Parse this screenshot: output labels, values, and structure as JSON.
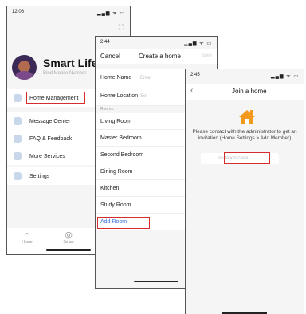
{
  "screen1": {
    "time": "12:06",
    "status_icons": "▂▄▆ ᯤ ▭",
    "brand": "Smart Life",
    "bind": "Bind Mobile Number",
    "menu": [
      {
        "label": "Home Management"
      },
      {
        "label": "Message Center"
      },
      {
        "label": "FAQ & Feedback"
      },
      {
        "label": "More Services"
      },
      {
        "label": "Settings"
      }
    ],
    "tabs": [
      {
        "label": "Home"
      },
      {
        "label": "Smart"
      }
    ]
  },
  "screen2": {
    "time": "2:44",
    "status_icons": "▂▄▆ ᯤ ▭",
    "cancel": "Cancel",
    "title": "Create a home",
    "save": "Save",
    "home_name_label": "Home Name",
    "home_name_hint": "Enter",
    "home_location_label": "Home Location",
    "home_location_hint": "Set",
    "rooms_header": "Rooms:",
    "rooms": [
      "Living Room",
      "Master Bedroom",
      "Second Bedroom",
      "Dining Room",
      "Kitchen",
      "Study Room"
    ],
    "add_room": "Add Room"
  },
  "screen3": {
    "time": "2:45",
    "status_icons": "▂▄▆ ᯤ ▭",
    "title": "Join a home",
    "message": "Please contact with the administrator to get an invitation (Home Settings > Add Member)",
    "invitation_placeholder": "Invitation code"
  },
  "colors": {
    "highlight": "#d62c2c",
    "house_orange": "#f39a1e",
    "link_blue": "#3a6fd8"
  }
}
